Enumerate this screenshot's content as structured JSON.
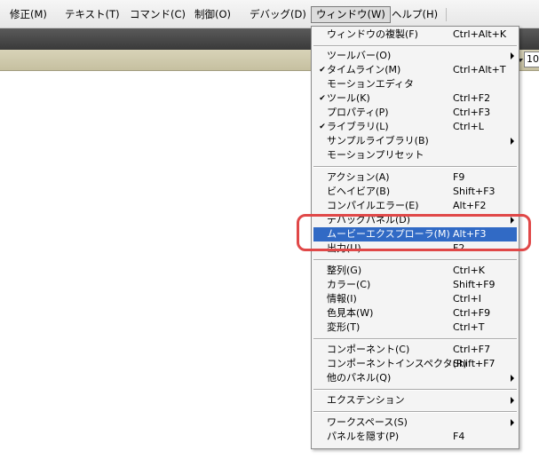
{
  "menubar": {
    "items": [
      {
        "label": "修正(M)"
      },
      {
        "label": "テキスト(T)"
      },
      {
        "label": "コマンド(C)"
      },
      {
        "label": "制御(O)"
      },
      {
        "label": "デバッグ(D)"
      },
      {
        "label": "ウィンドウ(W)",
        "active": true
      },
      {
        "label": "ヘルプ(H)"
      }
    ]
  },
  "toolbar": {
    "zoom_value": "10"
  },
  "window_menu": {
    "items": [
      {
        "label": "ウィンドウの複製(F)",
        "shortcut": "Ctrl+Alt+K"
      },
      {
        "label": "ツールバー(O)",
        "submenu": true
      },
      {
        "label": "タイムライン(M)",
        "shortcut": "Ctrl+Alt+T",
        "checked": true
      },
      {
        "label": "モーションエディタ"
      },
      {
        "label": "ツール(K)",
        "shortcut": "Ctrl+F2",
        "checked": true
      },
      {
        "label": "プロパティ(P)",
        "shortcut": "Ctrl+F3"
      },
      {
        "label": "ライブラリ(L)",
        "shortcut": "Ctrl+L",
        "checked": true
      },
      {
        "label": "サンプルライブラリ(B)",
        "submenu": true
      },
      {
        "label": "モーションプリセット"
      },
      {
        "label": "アクション(A)",
        "shortcut": "F9"
      },
      {
        "label": "ビヘイビア(B)",
        "shortcut": "Shift+F3"
      },
      {
        "label": "コンパイルエラー(E)",
        "shortcut": "Alt+F2"
      },
      {
        "label": "デバッグパネル(D)",
        "submenu": true
      },
      {
        "label": "ムービーエクスプローラ(M)",
        "shortcut": "Alt+F3",
        "highlighted": true
      },
      {
        "label": "出力(U)",
        "shortcut": "F2"
      },
      {
        "label": "整列(G)",
        "shortcut": "Ctrl+K"
      },
      {
        "label": "カラー(C)",
        "shortcut": "Shift+F9"
      },
      {
        "label": "情報(I)",
        "shortcut": "Ctrl+I"
      },
      {
        "label": "色見本(W)",
        "shortcut": "Ctrl+F9"
      },
      {
        "label": "変形(T)",
        "shortcut": "Ctrl+T"
      },
      {
        "label": "コンポーネント(C)",
        "shortcut": "Ctrl+F7"
      },
      {
        "label": "コンポーネントインスペクタ(R)",
        "shortcut": "Shift+F7"
      },
      {
        "label": "他のパネル(Q)",
        "submenu": true
      },
      {
        "label": "エクステンション",
        "submenu": true
      },
      {
        "label": "ワークスペース(S)",
        "submenu": true
      },
      {
        "label": "パネルを隠す(P)",
        "shortcut": "F4"
      }
    ],
    "check_glyph": "✔"
  },
  "colors": {
    "highlight": "#316ac5",
    "callout": "#e04848"
  }
}
